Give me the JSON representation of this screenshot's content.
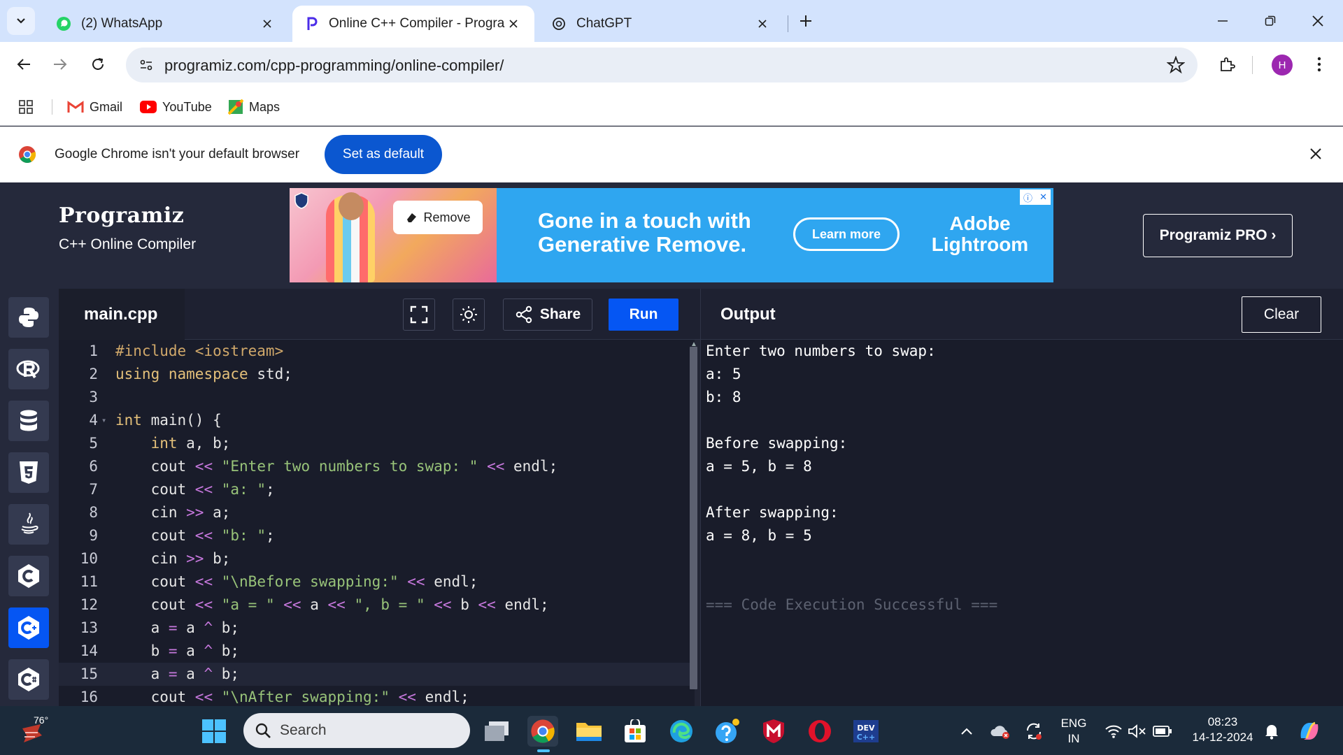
{
  "browser": {
    "tabs": [
      {
        "title": "(2) WhatsApp",
        "icon": "whatsapp-icon",
        "active": false
      },
      {
        "title": "Online C++ Compiler - Program",
        "icon": "programiz-icon",
        "active": true
      },
      {
        "title": "ChatGPT",
        "icon": "chatgpt-icon",
        "active": false
      }
    ],
    "url": "programiz.com/cpp-programming/online-compiler/",
    "avatar_letter": "H",
    "bookmarks": [
      {
        "label": "Gmail",
        "icon": "gmail-icon"
      },
      {
        "label": "YouTube",
        "icon": "youtube-icon"
      },
      {
        "label": "Maps",
        "icon": "maps-icon"
      }
    ],
    "infobar": {
      "message": "Google Chrome isn't your default browser",
      "button": "Set as default"
    }
  },
  "site": {
    "brand": "Programiz",
    "subtitle": "C++ Online Compiler",
    "pro_button": "Programiz PRO ›",
    "ad": {
      "remove_chip": "Remove",
      "headline_1": "Gone in a touch with",
      "headline_2": "Generative Remove.",
      "cta": "Learn more",
      "brand_1": "Adobe",
      "brand_2": "Lightroom"
    }
  },
  "editor": {
    "filename": "main.cpp",
    "share_label": "Share",
    "run_label": "Run",
    "current_line": 15,
    "lines": [
      {
        "n": "1",
        "t": "#include <iostream>"
      },
      {
        "n": "2",
        "t": "using namespace std;"
      },
      {
        "n": "3",
        "t": ""
      },
      {
        "n": "4",
        "t": "int main() {"
      },
      {
        "n": "5",
        "t": "    int a, b;"
      },
      {
        "n": "6",
        "t": "    cout << \"Enter two numbers to swap: \" << endl;"
      },
      {
        "n": "7",
        "t": "    cout << \"a: \";"
      },
      {
        "n": "8",
        "t": "    cin >> a;"
      },
      {
        "n": "9",
        "t": "    cout << \"b: \";"
      },
      {
        "n": "10",
        "t": "    cin >> b;"
      },
      {
        "n": "11",
        "t": "    cout << \"\\nBefore swapping:\" << endl;"
      },
      {
        "n": "12",
        "t": "    cout << \"a = \" << a << \", b = \" << b << endl;"
      },
      {
        "n": "13",
        "t": "    a = a ^ b;"
      },
      {
        "n": "14",
        "t": "    b = a ^ b;"
      },
      {
        "n": "15",
        "t": "    a = a ^ b;"
      },
      {
        "n": "16",
        "t": "    cout << \"\\nAfter swapping:\" << endl;"
      }
    ]
  },
  "output": {
    "title": "Output",
    "clear_label": "Clear",
    "lines": [
      "Enter two numbers to swap:",
      "a: 5",
      "b: 8",
      "",
      "Before swapping:",
      "a = 5, b = 8",
      "",
      "After swapping:",
      "a = 8, b = 5",
      "",
      "",
      "=== Code Execution Successful ==="
    ]
  },
  "taskbar": {
    "weather": "76°",
    "search_placeholder": "Search",
    "lang_1": "ENG",
    "lang_2": "IN",
    "time": "08:23",
    "date": "14-12-2024"
  },
  "colors": {
    "accent": "#0556f3",
    "header_bg": "#25293b",
    "editor_bg": "#191c2a",
    "chrome_tabstrip": "#d3e3fd",
    "chrome_button": "#0b57d0"
  }
}
